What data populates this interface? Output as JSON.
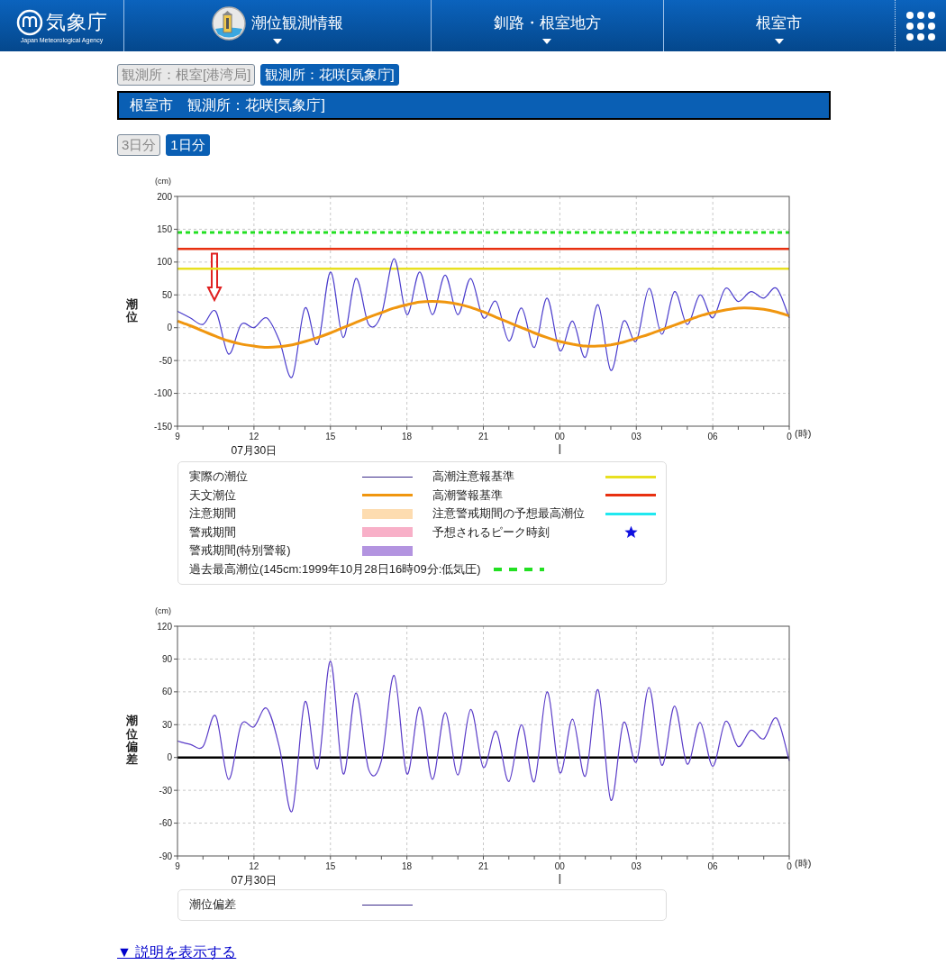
{
  "header": {
    "logo_text": "気象庁",
    "logo_subtext": "Japan Meteorological Agency",
    "nav": [
      {
        "label": "潮位観測情報",
        "kind": "icon"
      },
      {
        "label": "釧路・根室地方",
        "kind": "plain"
      },
      {
        "label": "根室市",
        "kind": "plain"
      }
    ]
  },
  "station_tabs": [
    {
      "label": "観測所：根室[港湾局]",
      "selected": false
    },
    {
      "label": "観測所：花咲[気象庁]",
      "selected": true
    }
  ],
  "title_bar": "根室市　観測所：花咲[気象庁]",
  "period_tabs": [
    {
      "label": "3日分",
      "selected": false
    },
    {
      "label": "1日分",
      "selected": true
    }
  ],
  "charts": [
    {
      "y_unit": "(cm)",
      "x_unit": "(時)",
      "date_label": "07月30日",
      "arrow_marker": {
        "color": "#e02020"
      },
      "chart_data": {
        "type": "line",
        "ylabel": "潮位",
        "grid": true,
        "categories": [
          "9",
          null,
          null,
          null,
          null,
          null,
          "12",
          null,
          null,
          null,
          null,
          null,
          "15",
          null,
          null,
          null,
          null,
          null,
          "18",
          null,
          null,
          null,
          null,
          null,
          "21",
          null,
          null,
          null,
          null,
          null,
          "00",
          null,
          null,
          null,
          null,
          null,
          "03",
          null,
          null,
          null,
          null,
          null,
          "06",
          null,
          null,
          null,
          null,
          null,
          "0"
        ],
        "ylim": [
          -150,
          200
        ],
        "yticks": [
          -150,
          -100,
          -50,
          0,
          50,
          100,
          150,
          200
        ],
        "series": [
          {
            "color": "#4a3ccc",
            "values": [
              25,
              15,
              5,
              25,
              -40,
              5,
              0,
              15,
              -20,
              -75,
              30,
              -25,
              85,
              -15,
              75,
              5,
              20,
              105,
              20,
              85,
              20,
              80,
              20,
              75,
              15,
              40,
              -20,
              30,
              -30,
              45,
              -35,
              10,
              -45,
              35,
              -65,
              10,
              -20,
              60,
              -10,
              55,
              5,
              50,
              15,
              60,
              40,
              55,
              45,
              60,
              15
            ]
          },
          {
            "color": "#f0960f",
            "values": [
              10,
              3,
              -5,
              -13,
              -20,
              -25,
              -28,
              -30,
              -29,
              -26,
              -21,
              -15,
              -8,
              0,
              8,
              16,
              23,
              30,
              35,
              39,
              40,
              39,
              36,
              31,
              24,
              16,
              8,
              0,
              -8,
              -15,
              -21,
              -25,
              -28,
              -28,
              -26,
              -22,
              -16,
              -10,
              -3,
              4,
              11,
              18,
              23,
              27,
              30,
              30,
              28,
              24,
              18
            ]
          },
          {
            "color": "#e8e020",
            "values": [
              90,
              90,
              90,
              90,
              90,
              90,
              90,
              90,
              90,
              90,
              90,
              90,
              90,
              90,
              90,
              90,
              90,
              90,
              90,
              90,
              90,
              90,
              90,
              90,
              90,
              90,
              90,
              90,
              90,
              90,
              90,
              90,
              90,
              90,
              90,
              90,
              90,
              90,
              90,
              90,
              90,
              90,
              90,
              90,
              90,
              90,
              90,
              90,
              90
            ]
          },
          {
            "color": "#e83010",
            "values": [
              120,
              120,
              120,
              120,
              120,
              120,
              120,
              120,
              120,
              120,
              120,
              120,
              120,
              120,
              120,
              120,
              120,
              120,
              120,
              120,
              120,
              120,
              120,
              120,
              120,
              120,
              120,
              120,
              120,
              120,
              120,
              120,
              120,
              120,
              120,
              120,
              120,
              120,
              120,
              120,
              120,
              120,
              120,
              120,
              120,
              120,
              120,
              120,
              120
            ]
          },
          {
            "color": "#22e022",
            "line_style": "dashed",
            "values": [
              145,
              145,
              145,
              145,
              145,
              145,
              145,
              145,
              145,
              145,
              145,
              145,
              145,
              145,
              145,
              145,
              145,
              145,
              145,
              145,
              145,
              145,
              145,
              145,
              145,
              145,
              145,
              145,
              145,
              145,
              145,
              145,
              145,
              145,
              145,
              145,
              145,
              145,
              145,
              145,
              145,
              145,
              145,
              145,
              145,
              145,
              145,
              145,
              145
            ]
          }
        ]
      },
      "legend": [
        {
          "label": "実際の潮位",
          "kind": "thin_line",
          "color": "#3a2a8a"
        },
        {
          "label": "高潮注意報基準",
          "kind": "line",
          "color": "#e8e020"
        },
        {
          "label": "天文潮位",
          "kind": "line",
          "color": "#f0960f"
        },
        {
          "label": "高潮警報基準",
          "kind": "line",
          "color": "#e83010"
        },
        {
          "label": "注意期間",
          "kind": "band",
          "color": "#fddcb0"
        },
        {
          "label": "注意警戒期間の予想最高潮位",
          "kind": "line",
          "color": "#20e8f0"
        },
        {
          "label": "警戒期間",
          "kind": "band",
          "color": "#f8b0c8"
        },
        {
          "label": "予想されるピーク時刻",
          "kind": "star",
          "color": "#1010e0"
        },
        {
          "label": "警戒期間(特別警報)",
          "kind": "band",
          "color": "#b394e0"
        },
        {
          "label": "過去最高潮位(145cm:1999年10月28日16時09分:低気圧)",
          "kind": "dashed",
          "color": "#22e022"
        }
      ]
    },
    {
      "y_unit": "(cm)",
      "x_unit": "(時)",
      "date_label": "07月30日",
      "chart_data": {
        "type": "line",
        "ylabel": "潮位偏差",
        "grid": true,
        "categories": [
          "9",
          null,
          null,
          null,
          null,
          null,
          "12",
          null,
          null,
          null,
          null,
          null,
          "15",
          null,
          null,
          null,
          null,
          null,
          "18",
          null,
          null,
          null,
          null,
          null,
          "21",
          null,
          null,
          null,
          null,
          null,
          "00",
          null,
          null,
          null,
          null,
          null,
          "03",
          null,
          null,
          null,
          null,
          null,
          "06",
          null,
          null,
          null,
          null,
          null,
          "0"
        ],
        "ylim": [
          -90,
          120
        ],
        "yticks": [
          -90,
          -60,
          -30,
          0,
          30,
          60,
          90,
          120
        ],
        "series": [
          {
            "color": "#5a3cc8",
            "values": [
              15,
              12,
              10,
              38,
              -20,
              30,
              28,
              45,
              9,
              -49,
              51,
              -10,
              88,
              -15,
              59,
              -11,
              -3,
              75,
              -15,
              46,
              -20,
              41,
              -16,
              44,
              -9,
              24,
              -22,
              30,
              -22,
              60,
              -14,
              35,
              -17,
              62,
              -39,
              32,
              -4,
              64,
              -7,
              47,
              -6,
              32,
              -8,
              33,
              10,
              25,
              17,
              36,
              -3
            ]
          },
          {
            "color": "#000000",
            "values": [
              0,
              0,
              0,
              0,
              0,
              0,
              0,
              0,
              0,
              0,
              0,
              0,
              0,
              0,
              0,
              0,
              0,
              0,
              0,
              0,
              0,
              0,
              0,
              0,
              0,
              0,
              0,
              0,
              0,
              0,
              0,
              0,
              0,
              0,
              0,
              0,
              0,
              0,
              0,
              0,
              0,
              0,
              0,
              0,
              0,
              0,
              0,
              0,
              0
            ]
          }
        ]
      },
      "legend": [
        {
          "label": "潮位偏差",
          "kind": "thin_line",
          "color": "#3a2a8a"
        }
      ]
    }
  ],
  "explain_link": "▼ 説明を表示する"
}
